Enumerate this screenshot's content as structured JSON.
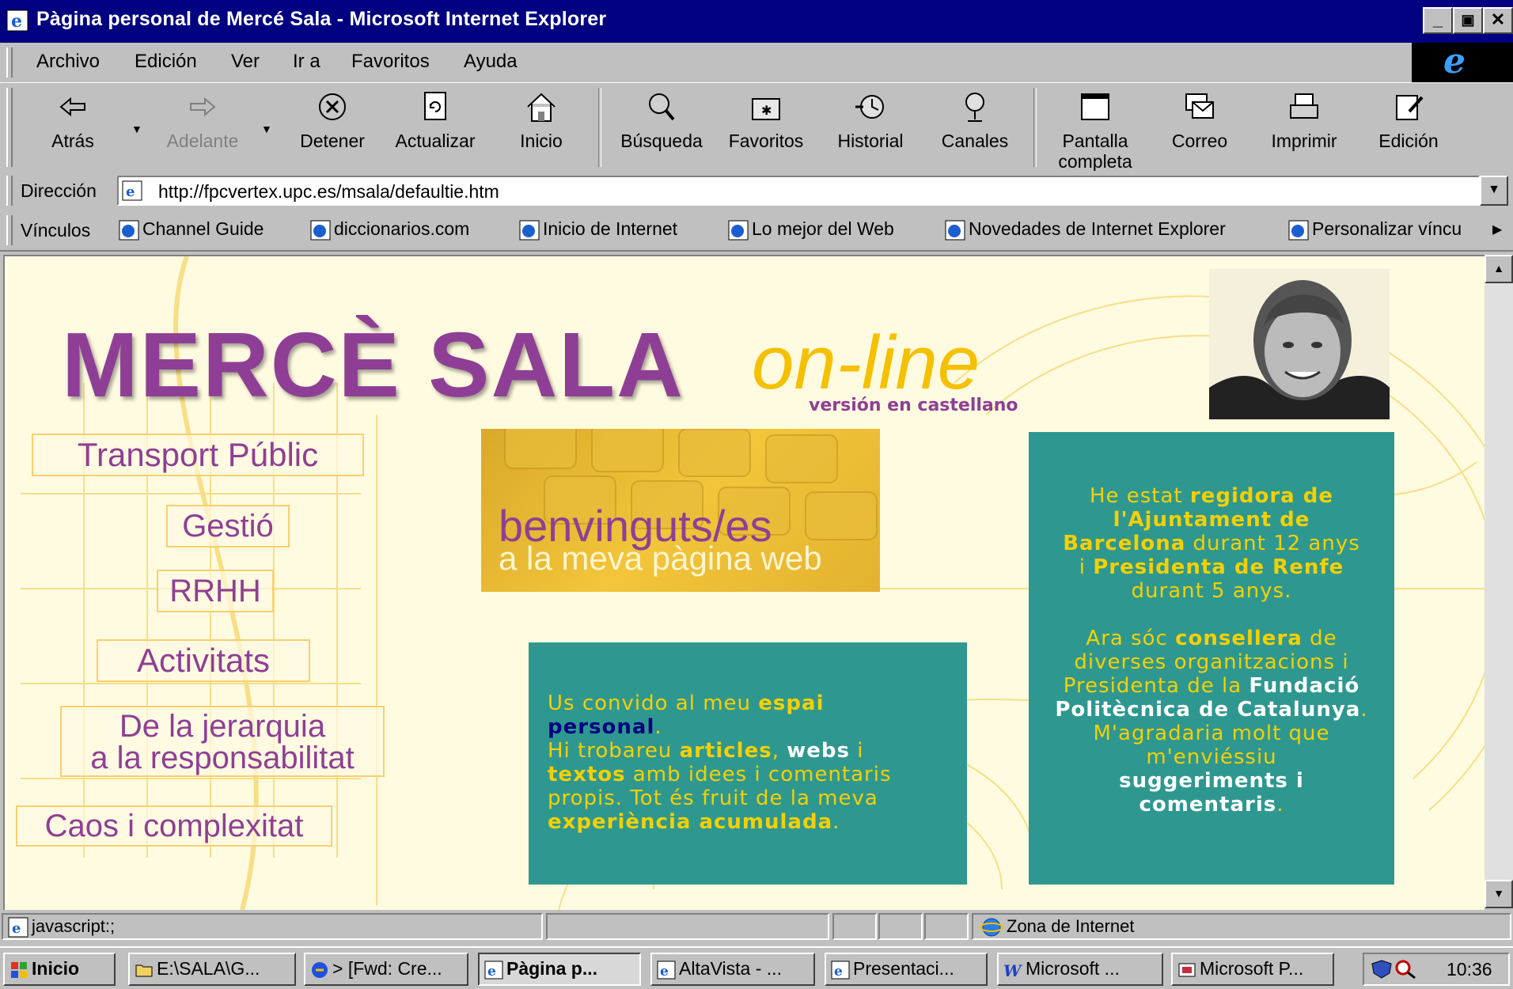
{
  "window": {
    "title": "Pàgina personal de Mercé Sala - Microsoft Internet Explorer",
    "buttons": [
      "_",
      "🗗",
      "✕"
    ]
  },
  "menu": [
    "Archivo",
    "Edición",
    "Ver",
    "Ir a",
    "Favoritos",
    "Ayuda"
  ],
  "toolbar": {
    "back": "Atrás",
    "forward": "Adelante",
    "stop": "Detener",
    "refresh": "Actualizar",
    "home": "Inicio",
    "search": "Búsqueda",
    "favorites": "Favoritos",
    "history": "Historial",
    "channels": "Canales",
    "fullscreen_1": "Pantalla",
    "fullscreen_2": "completa",
    "mail": "Correo",
    "print": "Imprimir",
    "edit": "Edición"
  },
  "address": {
    "label": "Dirección",
    "url": "http://fpcvertex.upc.es/msala/defaultie.htm"
  },
  "links": {
    "label": "Vínculos",
    "items": [
      "Channel Guide",
      "diccionarios.com",
      "Inicio de Internet",
      "Lo mejor del Web",
      "Novedades de Internet Explorer",
      "Personalizar víncu"
    ]
  },
  "page": {
    "title": "MERCÈ SALA",
    "online": "on-line",
    "castellano": "versión en castellano",
    "nav": [
      "Transport Públic",
      "Gestió",
      "RRHH",
      "Activitats",
      "De la jerarquia",
      "a la responsabilitat",
      "Caos i complexitat"
    ],
    "welcome_1": "benvinguts/es",
    "welcome_2": "a la meva pàgina web",
    "box1": {
      "t1": "Us convido al meu ",
      "b1": "espai",
      "n1": "personal",
      "t2": ".",
      "t3": "Hi trobareu ",
      "b2": "articles",
      "t4": ", ",
      "w1": "webs",
      "t5": " i",
      "b3": "textos",
      "t6": " amb idees i comentaris",
      "t7": "propis. Tot és fruit de la meva",
      "b4": "experiència acumulada",
      "t8": "."
    },
    "box2": {
      "t1": "He estat ",
      "b1": "regidora de",
      "b2": "l'Ajuntament de",
      "b3": "Barcelona",
      "t2": " durant 12 anys",
      "t3": "i ",
      "b4": "Presidenta de Renfe",
      "t4": "durant 5 anys.",
      "t5": "Ara sóc ",
      "b5": "consellera",
      "t6": " de",
      "t7": "diverses organitzacions i",
      "t8": "Presidenta de la ",
      "w1": "Fundació",
      "w2": "Politècnica de Catalunya",
      "t9": ".",
      "t10": "M'agradaria molt que",
      "t11": "m'enviéssiu",
      "w3": "suggeriments i",
      "w4": "comentaris",
      "t12": "."
    }
  },
  "status": {
    "text": "javascript:;",
    "zone": "Zona de Internet"
  },
  "taskbar": {
    "start": "Inicio",
    "tasks": [
      "E:\\SALA\\G...",
      "> [Fwd: Cre...",
      "Pàgina p...",
      "AltaVista - ...",
      "Presentaci...",
      "Microsoft ...",
      "Microsoft P..."
    ],
    "clock": "10:36"
  },
  "colors": {
    "titlebar": "#000080",
    "purple": "#8e3f95",
    "yellow": "#f5c000",
    "teal": "#2e9890",
    "page_bg": "#fffbe0"
  }
}
